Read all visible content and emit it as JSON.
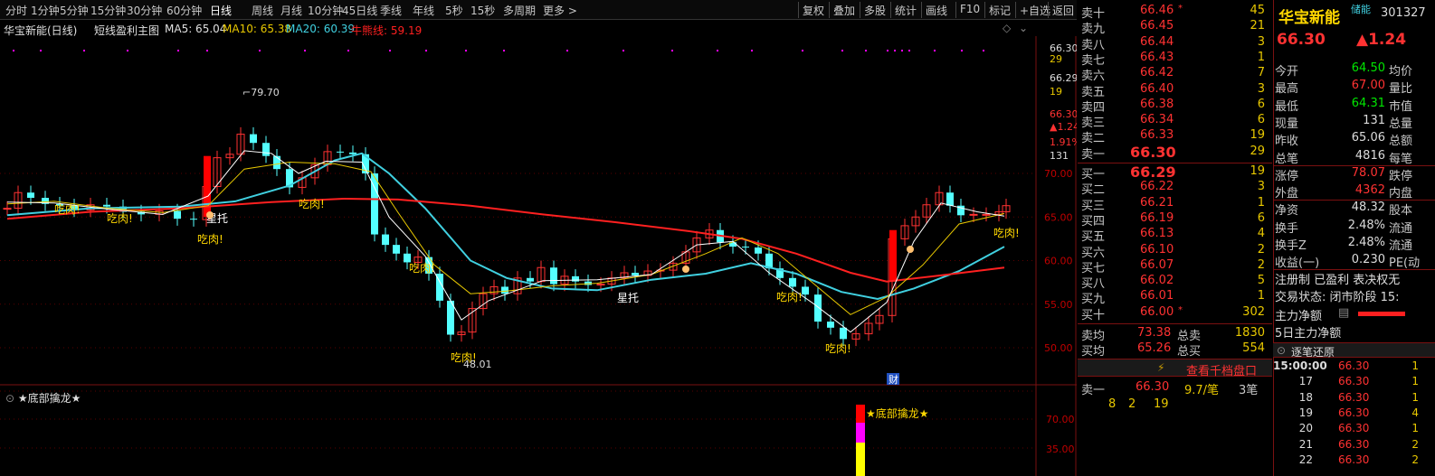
{
  "colors": {
    "up": "#ff3232",
    "down": "#54ffff",
    "ma5": "#ffffff",
    "ma10": "#e8c800",
    "ma20": "#40d0e0",
    "line": "#ff2020",
    "gold": "#ffd700",
    "green": "#00e600",
    "magenta": "#ff00ff"
  },
  "toolbar": {
    "periods": [
      "分时",
      "1分钟",
      "5分钟",
      "15分钟",
      "30分钟",
      "60分钟",
      "日线",
      "周线",
      "月线",
      "10分钟",
      "45日线",
      "季线",
      "年线",
      "5秒",
      "15秒",
      "多周期",
      "更多 >"
    ],
    "active_period": "日线",
    "buttons": [
      "复权",
      "叠加",
      "多股",
      "统计",
      "画线",
      "F10",
      "标记",
      "+自选",
      "返回"
    ]
  },
  "info": {
    "title": "华宝新能(日线)",
    "formula": "短线盈利主图",
    "ma5": "MA5: 65.04",
    "ma10": "MA10: 65.38",
    "ma20": "MA20: 60.39",
    "line": "牛熊线: 59.19"
  },
  "axis": {
    "y_labels": [
      "70.00",
      "65.00",
      "60.00",
      "55.00",
      "50.00"
    ],
    "right_top": [
      "66.30",
      "29",
      "66.29",
      "19",
      "66.30",
      "▲1.24",
      "1.91%",
      "131"
    ],
    "ind_labels": [
      "70.00",
      "35.00"
    ]
  },
  "annotations": {
    "high": "79.70",
    "low": "48.01",
    "eat": "吃肉!",
    "support": "星托",
    "cai": "财"
  },
  "indicator": {
    "title": "★底部擒龙★",
    "signal": "★底部擒龙★"
  },
  "orderbook": {
    "sells": [
      {
        "label": "卖十",
        "price": "66.46",
        "flag": "*",
        "vol": "45"
      },
      {
        "label": "卖九",
        "price": "66.45",
        "flag": "",
        "vol": "21"
      },
      {
        "label": "卖八",
        "price": "66.44",
        "flag": "",
        "vol": "3"
      },
      {
        "label": "卖七",
        "price": "66.43",
        "flag": "",
        "vol": "1"
      },
      {
        "label": "卖六",
        "price": "66.42",
        "flag": "",
        "vol": "7"
      },
      {
        "label": "卖五",
        "price": "66.40",
        "flag": "",
        "vol": "3"
      },
      {
        "label": "卖四",
        "price": "66.38",
        "flag": "",
        "vol": "6"
      },
      {
        "label": "卖三",
        "price": "66.34",
        "flag": "",
        "vol": "6"
      },
      {
        "label": "卖二",
        "price": "66.33",
        "flag": "",
        "vol": "19"
      },
      {
        "label": "卖一",
        "price": "66.30",
        "flag": "",
        "vol": "29"
      }
    ],
    "buys": [
      {
        "label": "买一",
        "price": "66.29",
        "flag": "",
        "vol": "19"
      },
      {
        "label": "买二",
        "price": "66.22",
        "flag": "",
        "vol": "3"
      },
      {
        "label": "买三",
        "price": "66.21",
        "flag": "",
        "vol": "1"
      },
      {
        "label": "买四",
        "price": "66.19",
        "flag": "",
        "vol": "6"
      },
      {
        "label": "买五",
        "price": "66.13",
        "flag": "",
        "vol": "4"
      },
      {
        "label": "买六",
        "price": "66.10",
        "flag": "",
        "vol": "2"
      },
      {
        "label": "买七",
        "price": "66.07",
        "flag": "",
        "vol": "2"
      },
      {
        "label": "买八",
        "price": "66.02",
        "flag": "",
        "vol": "5"
      },
      {
        "label": "买九",
        "price": "66.01",
        "flag": "",
        "vol": "1"
      },
      {
        "label": "买十",
        "price": "66.00",
        "flag": "*",
        "vol": "302"
      }
    ],
    "avg_sell": {
      "label": "卖均",
      "price": "73.38",
      "k": "总卖",
      "v": "1830"
    },
    "avg_buy": {
      "label": "买均",
      "price": "65.26",
      "k": "总买",
      "v": "554"
    },
    "link": "查看千档盘口",
    "level1": {
      "label": "卖一",
      "price": "66.30",
      "ratio": "9.7/笔",
      "count": "3笔"
    },
    "splits": [
      "8",
      "2",
      "19"
    ]
  },
  "quote": {
    "name": "华宝新能",
    "tag": "储能",
    "code": "301327",
    "price": "66.30",
    "change": "▲1.24",
    "rows": [
      {
        "k": "今开",
        "v": "64.50",
        "c": "green",
        "k2": "均价"
      },
      {
        "k": "最高",
        "v": "67.00",
        "c": "up",
        "k2": "量比"
      },
      {
        "k": "最低",
        "v": "64.31",
        "c": "green",
        "k2": "市值"
      },
      {
        "k": "现量",
        "v": "131",
        "c": "white",
        "k2": "总量"
      },
      {
        "k": "昨收",
        "v": "65.06",
        "c": "white",
        "k2": "总额"
      },
      {
        "k": "总笔",
        "v": "4816",
        "c": "white",
        "k2": "每笔"
      },
      {
        "k": "涨停",
        "v": "78.07",
        "c": "up",
        "k2": "跌停"
      },
      {
        "k": "外盘",
        "v": "4362",
        "c": "up",
        "k2": "内盘"
      },
      {
        "k": "净资",
        "v": "48.32",
        "c": "white",
        "k2": "股本"
      },
      {
        "k": "换手",
        "v": "2.48%",
        "c": "white",
        "k2": "流通"
      },
      {
        "k": "换手Z",
        "v": "2.48%",
        "c": "white",
        "k2": "流通"
      },
      {
        "k": "收益(一)",
        "v": "0.230",
        "c": "white",
        "k2": "PE(动"
      }
    ],
    "reg": "注册制 已盈利 表决权无",
    "status": "交易状态: 闭市阶段 15:",
    "main_net": "主力净额",
    "main_net5": "5日主力净额",
    "ticks_title": "逐笔还原",
    "ticks": [
      {
        "t": "15:00:00",
        "p": "66.30",
        "v": "1"
      },
      {
        "t": "17",
        "p": "66.30",
        "v": "1"
      },
      {
        "t": "18",
        "p": "66.30",
        "v": "1"
      },
      {
        "t": "19",
        "p": "66.30",
        "v": "4"
      },
      {
        "t": "20",
        "p": "66.30",
        "v": "1"
      },
      {
        "t": "21",
        "p": "66.30",
        "v": "2"
      },
      {
        "t": "22",
        "p": "66.30",
        "v": "2"
      }
    ]
  }
}
